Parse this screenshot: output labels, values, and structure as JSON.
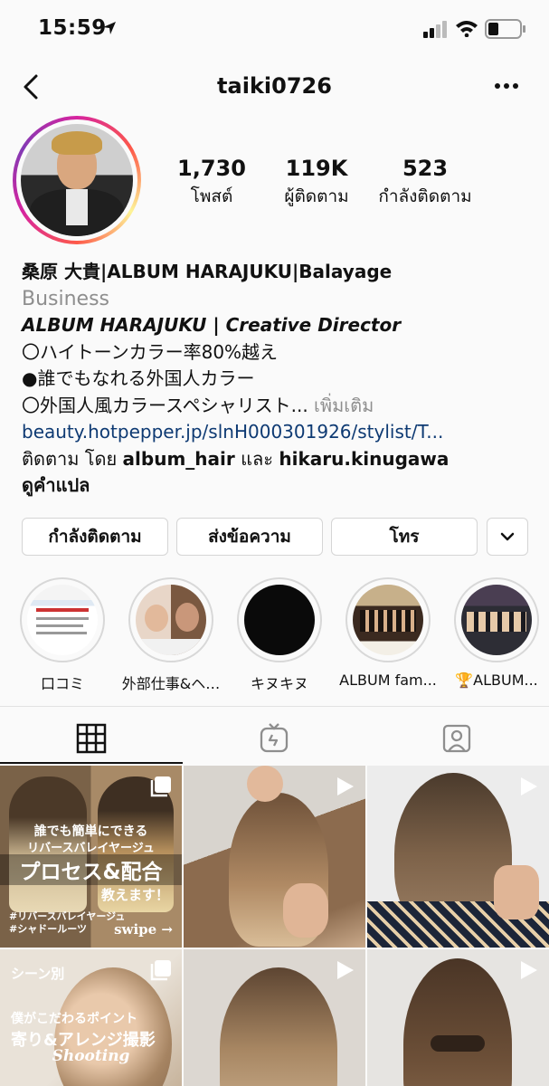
{
  "status": {
    "time": "15:59"
  },
  "nav": {
    "username": "taiki0726"
  },
  "stats": [
    {
      "value": "1,730",
      "label": "โพสต์"
    },
    {
      "value": "119K",
      "label": "ผู้ติดตาม"
    },
    {
      "value": "523",
      "label": "กำลังติดตาม"
    }
  ],
  "bio": {
    "name": "桑原 大貴|ALBUM HARAJUKU|Balayage",
    "category": "Business",
    "role": "ALBUM HARAJUKU | Creative Director",
    "line1": "〇ハイトーンカラー率80%越え",
    "line2": "●誰でもなれる外国人カラー",
    "line3": "〇外国人風カラースペシャリスト...",
    "more": "เพิ่มเติม",
    "link": "beauty.hotpepper.jp/slnH000301926/stylist/T...",
    "followed_prefix": "ติดตาม โดย",
    "followed_user1": "album_hair",
    "followed_and": "และ",
    "followed_user2": "hikaru.kinugawa",
    "translate": "ดูคำแปล"
  },
  "buttons": {
    "following": "กำลังติดตาม",
    "message": "ส่งข้อความ",
    "call": "โทร"
  },
  "highlights": [
    {
      "label": "口コミ"
    },
    {
      "label": "外部仕事&ヘ…"
    },
    {
      "label": "キヌキヌ"
    },
    {
      "label": "ALBUM fam..."
    },
    {
      "label": "🏆ALBUM..."
    }
  ],
  "posts": {
    "p1_line1": "誰でも簡単にできる",
    "p1_line2": "リバースバレイヤージュ",
    "p1_line3": "プロセス&配合",
    "p1_line4": "教えます！",
    "p1_tag1": "#リバースバレイヤージュ",
    "p1_tag2": "#シャドールーツ",
    "p1_swipe": "swipe →",
    "p4_line1": "シーン別",
    "p4_line2": "僕がこだわるポイント",
    "p4_line3": "寄り&アレンジ撮影",
    "p4_line4": "Shooting"
  }
}
